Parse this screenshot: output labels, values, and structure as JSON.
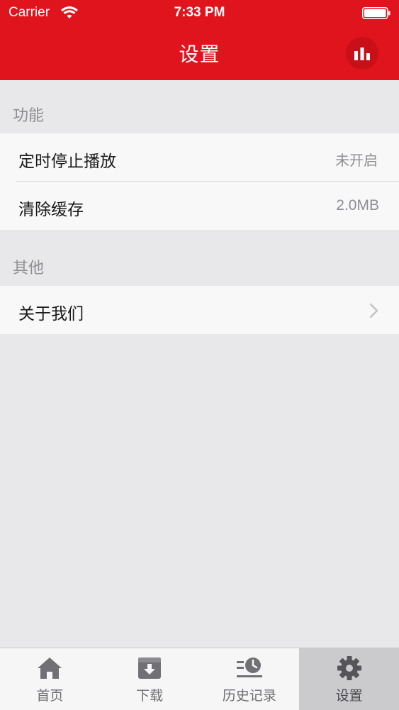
{
  "status_bar": {
    "carrier": "Carrier",
    "time": "7:33 PM",
    "wifi_icon": "wifi-icon",
    "battery_icon": "battery-icon"
  },
  "nav": {
    "title": "设置",
    "right_icon": "bar-chart-icon"
  },
  "colors": {
    "brand": "#e0141d",
    "background": "#e8e8ea",
    "secondary_text": "#8e8e93"
  },
  "sections": [
    {
      "header": "功能",
      "rows": [
        {
          "label": "定时停止播放",
          "value": "未开启"
        },
        {
          "label": "清除缓存",
          "value": "2.0MB"
        }
      ]
    },
    {
      "header": "其他",
      "rows": [
        {
          "label": "关于我们",
          "accessory": "chevron-right-icon"
        }
      ]
    }
  ],
  "tabbar": {
    "active": "设置",
    "items": [
      {
        "label": "首页",
        "icon": "home-icon"
      },
      {
        "label": "下载",
        "icon": "download-icon"
      },
      {
        "label": "历史记录",
        "icon": "history-icon"
      },
      {
        "label": "设置",
        "icon": "gear-icon"
      }
    ]
  }
}
